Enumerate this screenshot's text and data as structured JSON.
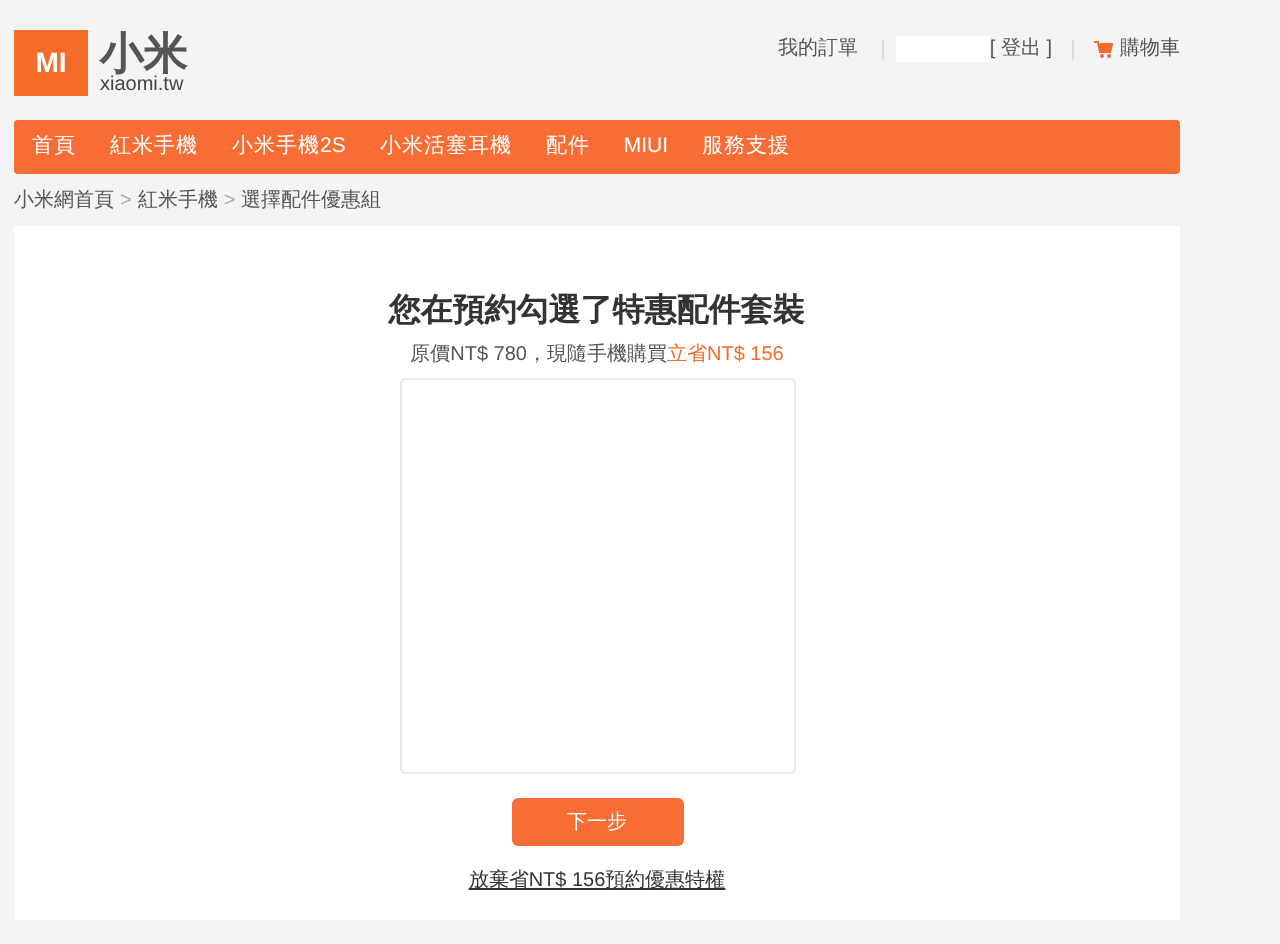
{
  "logo": {
    "mark": "MI",
    "name": "小米",
    "domain": "xiaomi.tw"
  },
  "top_links": {
    "orders": "我的訂單",
    "logout": "[ 登出 ]",
    "cart": "購物車"
  },
  "nav": [
    {
      "label": "首頁"
    },
    {
      "label": "紅米手機"
    },
    {
      "label": "小米手機2S"
    },
    {
      "label": "小米活塞耳機"
    },
    {
      "label": "配件"
    },
    {
      "label": "MIUI"
    },
    {
      "label": "服務支援"
    }
  ],
  "breadcrumb": [
    "小米網首頁",
    "紅米手機",
    "選擇配件優惠組"
  ],
  "breadcrumb_separator": ">",
  "title": "您在預約勾選了特惠配件套裝",
  "subtitle": {
    "text": "原價NT$ 780，現隨手機購買",
    "highlight": "立省NT$ 156"
  },
  "next_button": "下一步",
  "skip_link": "放棄省NT$ 156預約優惠特權"
}
